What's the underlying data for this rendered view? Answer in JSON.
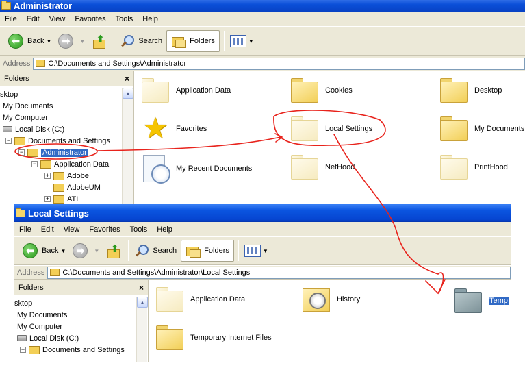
{
  "window1": {
    "title": "Administrator",
    "menu": [
      "File",
      "Edit",
      "View",
      "Favorites",
      "Tools",
      "Help"
    ],
    "toolbar": {
      "back": "Back",
      "search": "Search",
      "folders": "Folders"
    },
    "address": {
      "label": "Address",
      "path": "C:\\Documents and Settings\\Administrator"
    },
    "pane": {
      "title": "Folders",
      "close": "×",
      "tree": [
        {
          "label": "sktop",
          "indent": 0,
          "icon": "none",
          "expander": ""
        },
        {
          "label": "My Documents",
          "indent": 0,
          "icon": "none",
          "expander": ""
        },
        {
          "label": "My Computer",
          "indent": 0,
          "icon": "none",
          "expander": ""
        },
        {
          "label": "Local Disk (C:)",
          "indent": 0,
          "icon": "drive",
          "expander": ""
        },
        {
          "label": "Documents and Settings",
          "indent": 1,
          "icon": "folder",
          "expander": "−"
        },
        {
          "label": "Administrator",
          "indent": 2,
          "icon": "folder",
          "expander": "−",
          "selected": true
        },
        {
          "label": "Application Data",
          "indent": 3,
          "icon": "folder",
          "expander": "−"
        },
        {
          "label": "Adobe",
          "indent": 4,
          "icon": "folder",
          "expander": "+"
        },
        {
          "label": "AdobeUM",
          "indent": 4,
          "icon": "folder",
          "expander": ""
        },
        {
          "label": "ATI",
          "indent": 4,
          "icon": "folder",
          "expander": "+"
        }
      ]
    },
    "items": [
      {
        "label": "Application Data",
        "icon": "folder-faded"
      },
      {
        "label": "Cookies",
        "icon": "folder"
      },
      {
        "label": "Desktop",
        "icon": "folder"
      },
      {
        "label": "Favorites",
        "icon": "star"
      },
      {
        "label": "Local Settings",
        "icon": "folder-faded"
      },
      {
        "label": "My Documents",
        "icon": "folder"
      },
      {
        "label": "My Recent Documents",
        "icon": "recent"
      },
      {
        "label": "NetHood",
        "icon": "folder-faded"
      },
      {
        "label": "PrintHood",
        "icon": "folder-faded"
      }
    ]
  },
  "window2": {
    "title": "Local Settings",
    "menu": [
      "File",
      "Edit",
      "View",
      "Favorites",
      "Tools",
      "Help"
    ],
    "toolbar": {
      "back": "Back",
      "search": "Search",
      "folders": "Folders"
    },
    "address": {
      "label": "Address",
      "path": "C:\\Documents and Settings\\Administrator\\Local Settings"
    },
    "pane": {
      "title": "Folders",
      "close": "×",
      "tree": [
        {
          "label": "sktop",
          "indent": 0,
          "icon": "none",
          "expander": ""
        },
        {
          "label": "My Documents",
          "indent": 0,
          "icon": "none",
          "expander": ""
        },
        {
          "label": "My Computer",
          "indent": 0,
          "icon": "none",
          "expander": ""
        },
        {
          "label": "Local Disk (C:)",
          "indent": 0,
          "icon": "drive",
          "expander": ""
        },
        {
          "label": "Documents and Settings",
          "indent": 1,
          "icon": "folder",
          "expander": "−"
        }
      ]
    },
    "items": [
      {
        "label": "Application Data",
        "icon": "folder-faded"
      },
      {
        "label": "History",
        "icon": "history"
      },
      {
        "label": "Temp",
        "icon": "folder-grey",
        "selected": true
      },
      {
        "label": "Temporary Internet Files",
        "icon": "folder"
      }
    ]
  },
  "annotation_color": "#e8231c"
}
